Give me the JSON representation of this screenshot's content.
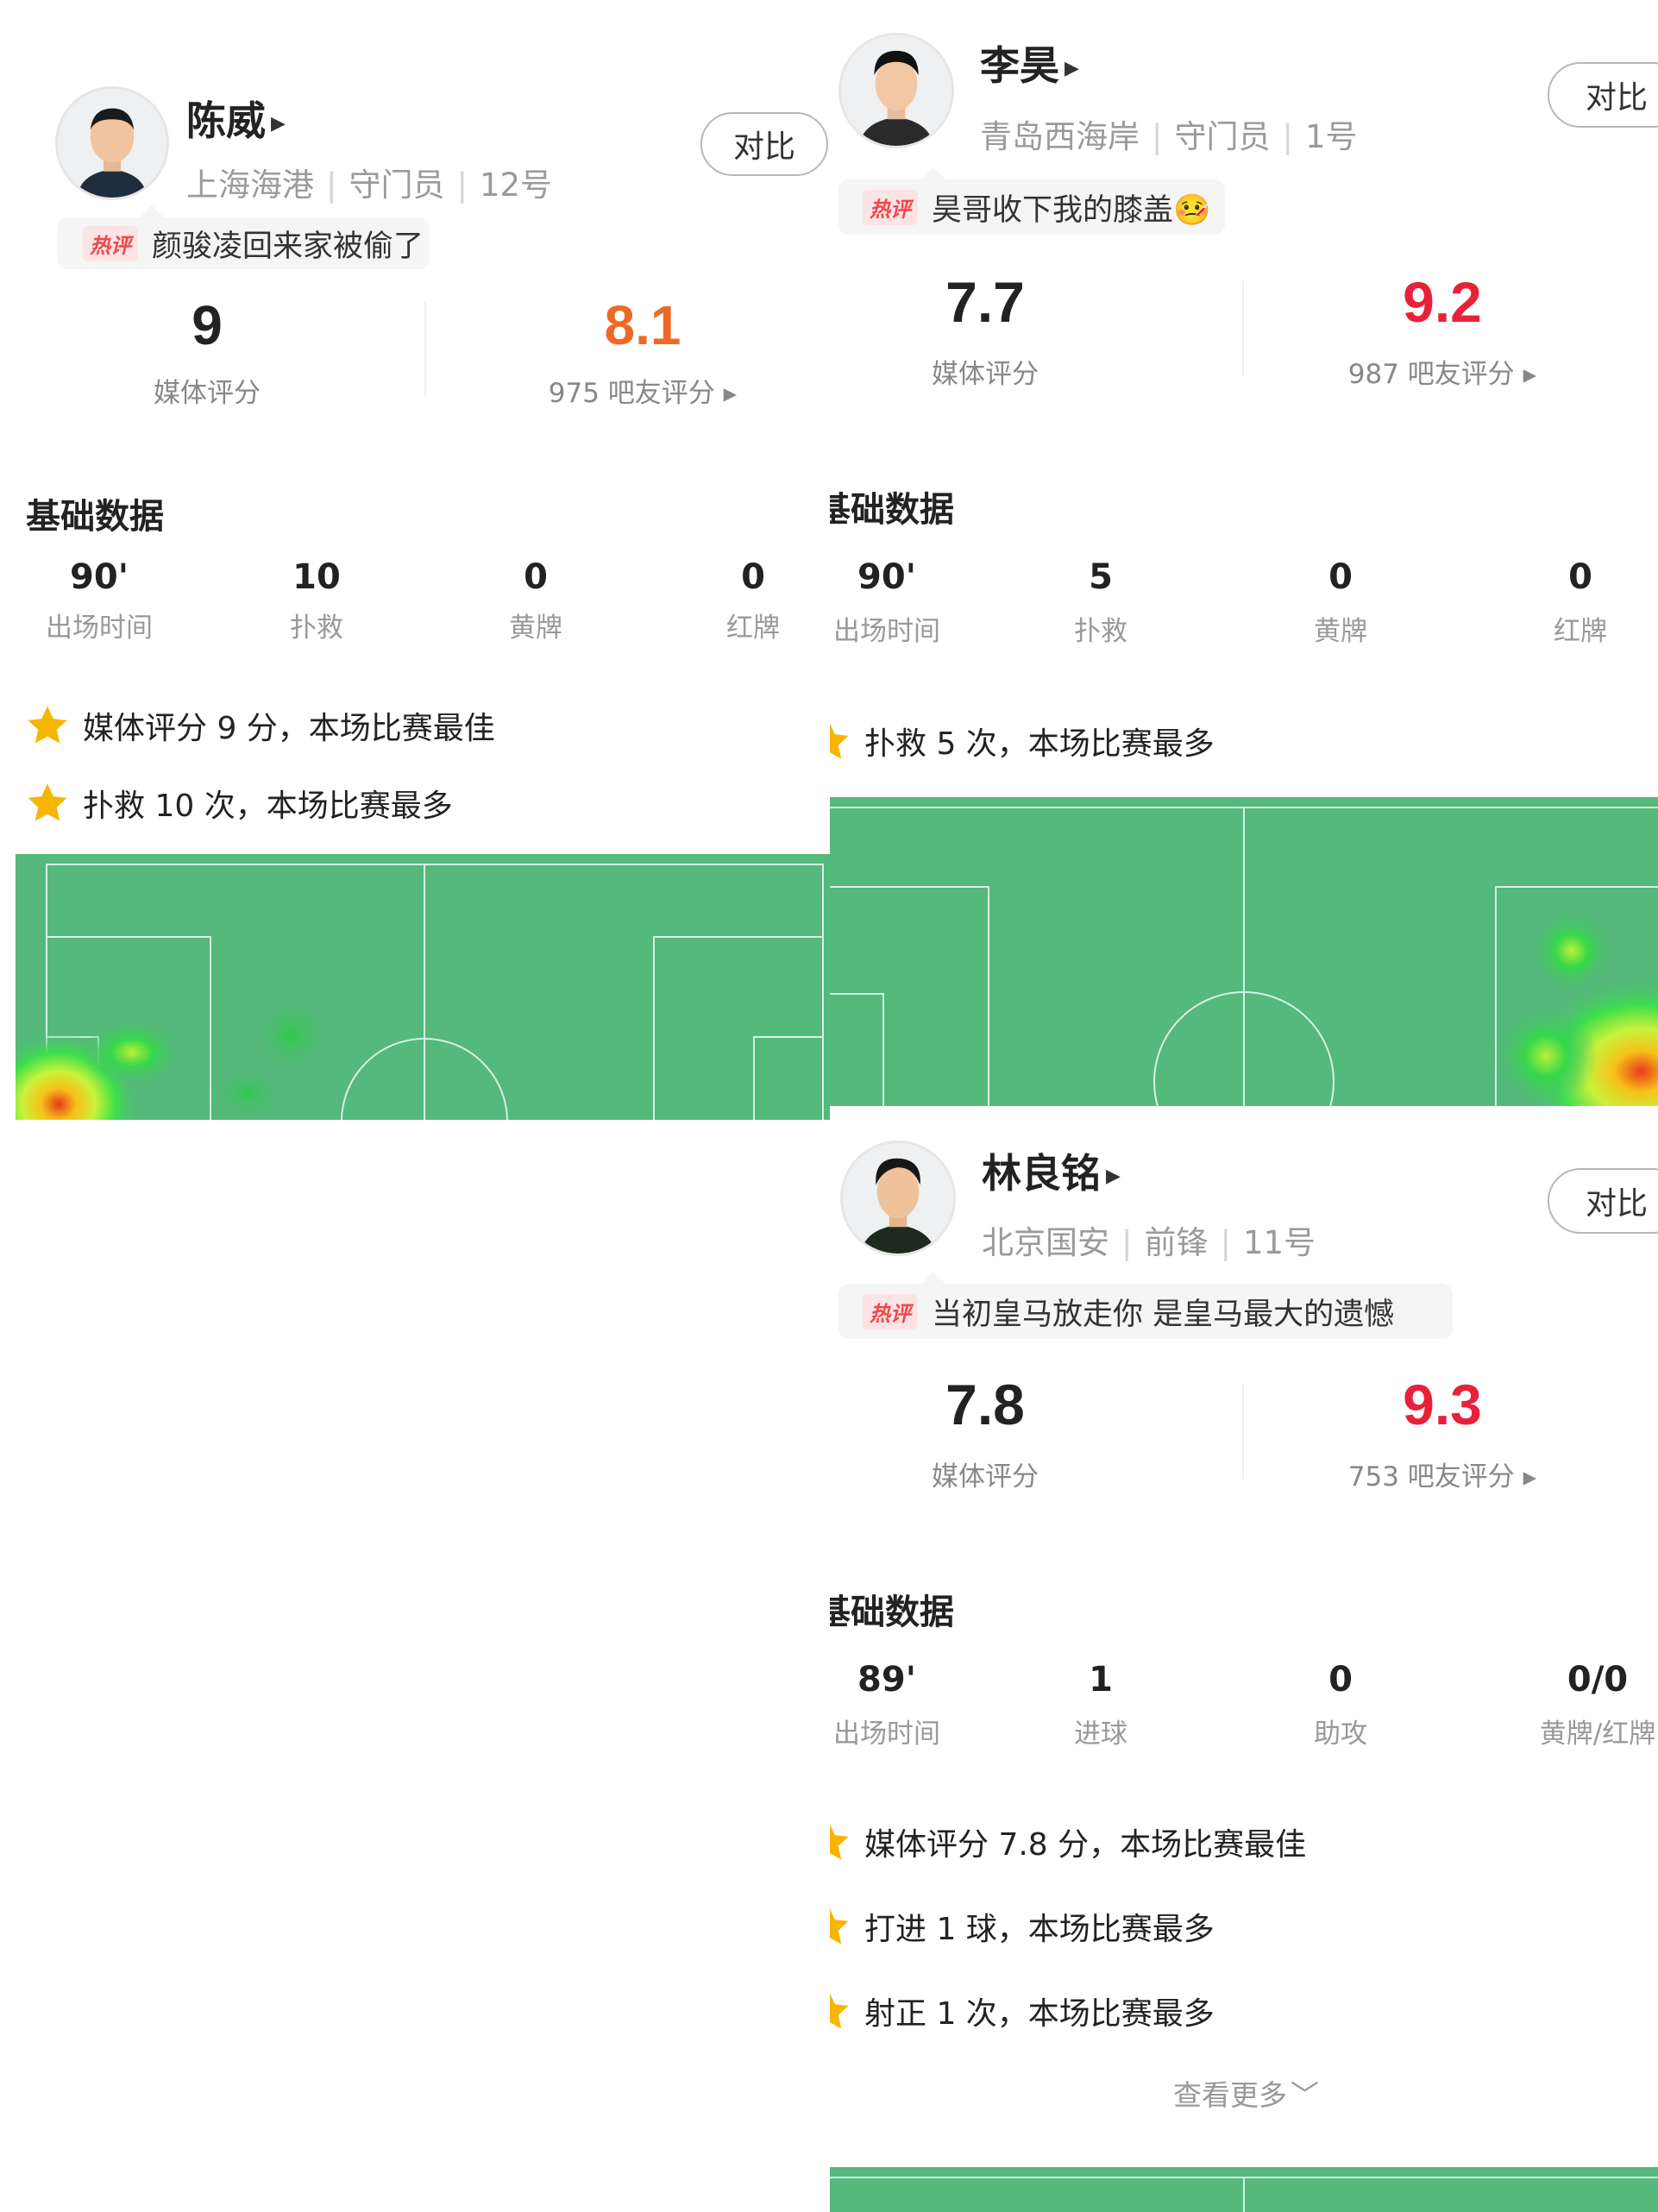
{
  "players": [
    {
      "name": "陈威",
      "team": "上海海港",
      "position": "守门员",
      "number": "12号",
      "compare_label": "对比",
      "hot_badge": "热评",
      "hot_comment": "颜骏凌回来家被偷了",
      "media_score": "9",
      "media_label": "媒体评分",
      "fan_score": "8.1",
      "fan_label": "975 吧友评分 ▸",
      "section_title": "基础数据",
      "stats": [
        {
          "value": "90'",
          "label": "出场时间"
        },
        {
          "value": "10",
          "label": "扑救"
        },
        {
          "value": "0",
          "label": "黄牌"
        },
        {
          "value": "0",
          "label": "红牌"
        }
      ],
      "highlights": [
        "媒体评分 9 分，本场比赛最佳",
        "扑救 10 次，本场比赛最多"
      ]
    },
    {
      "name": "李昊",
      "team": "青岛西海岸",
      "position": "守门员",
      "number": "1号",
      "compare_label": "对比",
      "hot_badge": "热评",
      "hot_comment": "昊哥收下我的膝盖🤒",
      "media_score": "7.7",
      "media_label": "媒体评分",
      "fan_score": "9.2",
      "fan_label": "987 吧友评分 ▸",
      "section_title": "基础数据",
      "stats": [
        {
          "value": "90'",
          "label": "出场时间"
        },
        {
          "value": "5",
          "label": "扑救"
        },
        {
          "value": "0",
          "label": "黄牌"
        },
        {
          "value": "0",
          "label": "红牌"
        }
      ],
      "highlights": [
        "扑救 5 次，本场比赛最多"
      ]
    },
    {
      "name": "林良铭",
      "team": "北京国安",
      "position": "前锋",
      "number": "11号",
      "compare_label": "对比",
      "hot_badge": "热评",
      "hot_comment": "当初皇马放走你 是皇马最大的遗憾",
      "media_score": "7.8",
      "media_label": "媒体评分",
      "fan_score": "9.3",
      "fan_label": "753 吧友评分 ▸",
      "section_title": "基础数据",
      "stats": [
        {
          "value": "89'",
          "label": "出场时间"
        },
        {
          "value": "1",
          "label": "进球"
        },
        {
          "value": "0",
          "label": "助攻"
        },
        {
          "value": "0/0",
          "label": "黄牌/红牌"
        }
      ],
      "highlights": [
        "媒体评分 7.8 分，本场比赛最佳",
        "打进 1 球，本场比赛最多",
        "射正 1 次，本场比赛最多"
      ],
      "more_label": "查看更多"
    }
  ],
  "icons": {
    "name_arrow": "play-triangle-icon",
    "highlight": "star-icon",
    "more": "chevron-down-icon"
  },
  "colors": {
    "fan_score_orange": "#ee6a24",
    "fan_score_red": "#e8213a",
    "pitch_green": "#54b97a",
    "star_yellow": "#f7b500",
    "hot_badge_red": "#f04848"
  }
}
